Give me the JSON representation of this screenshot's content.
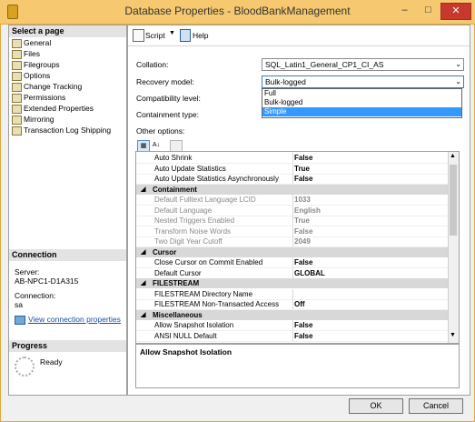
{
  "window": {
    "title": "Database Properties - BloodBankManagement",
    "minimize": "–",
    "maximize": "□",
    "close": "✕"
  },
  "sidebar": {
    "header": "Select a page",
    "items": [
      {
        "label": "General"
      },
      {
        "label": "Files"
      },
      {
        "label": "Filegroups"
      },
      {
        "label": "Options"
      },
      {
        "label": "Change Tracking"
      },
      {
        "label": "Permissions"
      },
      {
        "label": "Extended Properties"
      },
      {
        "label": "Mirroring"
      },
      {
        "label": "Transaction Log Shipping"
      }
    ],
    "connection": {
      "header": "Connection",
      "server_label": "Server:",
      "server_value": "AB-NPC1-D1A315",
      "connection_label": "Connection:",
      "connection_value": "sa",
      "link": "View connection properties"
    },
    "progress": {
      "header": "Progress",
      "status": "Ready"
    }
  },
  "toolbar": {
    "script_label": "Script",
    "help_label": "Help"
  },
  "form": {
    "collation_label": "Collation:",
    "collation_value": "SQL_Latin1_General_CP1_CI_AS",
    "recovery_label": "Recovery model:",
    "recovery_value": "Bulk-logged",
    "compat_label": "Compatibility level:",
    "containment_label": "Containment type:",
    "other_options_label": "Other options:",
    "recovery_options": [
      "Full",
      "Bulk-logged",
      "Simple"
    ]
  },
  "grid": {
    "rows": [
      {
        "name": "Auto Shrink",
        "value": "False"
      },
      {
        "name": "Auto Update Statistics",
        "value": "True"
      },
      {
        "name": "Auto Update Statistics Asynchronously",
        "value": "False"
      },
      {
        "category": "Containment"
      },
      {
        "name": "Default Fulltext Language LCID",
        "value": "1033",
        "dim": true
      },
      {
        "name": "Default Language",
        "value": "English",
        "dim": true
      },
      {
        "name": "Nested Triggers Enabled",
        "value": "True",
        "dim": true
      },
      {
        "name": "Transform Noise Words",
        "value": "False",
        "dim": true
      },
      {
        "name": "Two Digit Year Cutoff",
        "value": "2049",
        "dim": true
      },
      {
        "category": "Cursor"
      },
      {
        "name": "Close Cursor on Commit Enabled",
        "value": "False"
      },
      {
        "name": "Default Cursor",
        "value": "GLOBAL"
      },
      {
        "category": "FILESTREAM"
      },
      {
        "name": "FILESTREAM Directory Name",
        "value": ""
      },
      {
        "name": "FILESTREAM Non-Transacted Access",
        "value": "Off"
      },
      {
        "category": "Miscellaneous"
      },
      {
        "name": "Allow Snapshot Isolation",
        "value": "False"
      },
      {
        "name": "ANSI NULL Default",
        "value": "False"
      }
    ]
  },
  "description": {
    "title": "Allow Snapshot Isolation"
  },
  "buttons": {
    "ok": "OK",
    "cancel": "Cancel"
  }
}
